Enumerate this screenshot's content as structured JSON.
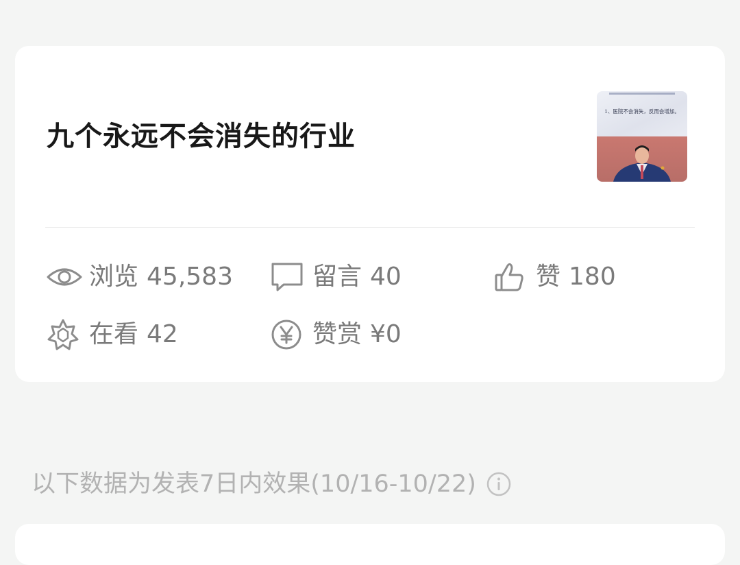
{
  "article": {
    "title": "九个永远不会消失的行业",
    "thumbnail_caption": "1、医院不会消失，反而会增加。",
    "thumbnail_icon": "person-photo"
  },
  "stats": {
    "views": {
      "label": "浏览",
      "value": "45,583",
      "icon": "eye-icon"
    },
    "comments": {
      "label": "留言",
      "value": "40",
      "icon": "comment-icon"
    },
    "likes": {
      "label": "赞",
      "value": "180",
      "icon": "thumbs-up-icon"
    },
    "watching": {
      "label": "在看",
      "value": "42",
      "icon": "star-icon"
    },
    "rewards": {
      "label": "赞赏",
      "value": "¥0",
      "icon": "yen-icon"
    }
  },
  "footer_note": {
    "text": "以下数据为发表7日内效果(10/16-10/22)",
    "icon": "info-icon"
  },
  "colors": {
    "background": "#f4f5f4",
    "card": "#ffffff",
    "title": "#181818",
    "stat_text": "#7a7a7a",
    "note_text": "#b2b2b2"
  }
}
